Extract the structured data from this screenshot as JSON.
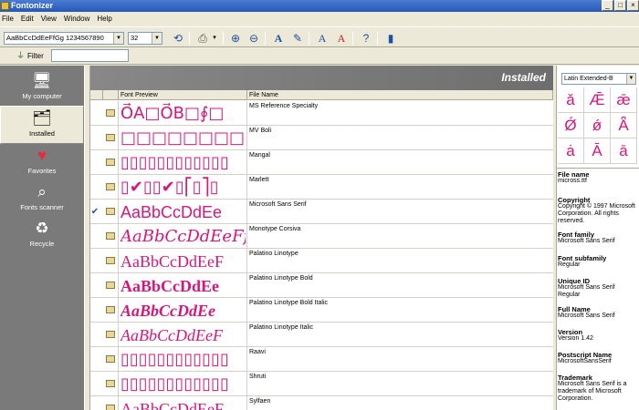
{
  "window": {
    "title": "Fontonizer"
  },
  "menu": [
    "File",
    "Edit",
    "View",
    "Window",
    "Help"
  ],
  "toolbar": {
    "sample_text": "AaBbCcDdEeFfGg 1234567890",
    "font_size": "32"
  },
  "filter": {
    "label": "Filter",
    "value": ""
  },
  "sidebar": {
    "items": [
      {
        "label": "My computer",
        "icon": "computer-icon",
        "active": false
      },
      {
        "label": "Installed",
        "icon": "installed-fonts-icon",
        "active": true
      },
      {
        "label": "Favorites",
        "icon": "heart-icon",
        "active": false
      },
      {
        "label": "Fonts scanner",
        "icon": "scanner-icon",
        "active": false
      },
      {
        "label": "Recycle",
        "icon": "recycle-icon",
        "active": false
      }
    ]
  },
  "main": {
    "banner_title": "Installed",
    "columns": {
      "preview": "Font Preview",
      "file": "File Name"
    },
    "rows": [
      {
        "preview": "O⃗A□O⃗B□∮□",
        "file": "MS Reference Specialty",
        "checked": false,
        "preview_font": "\"DejaVu Sans\", sans-serif"
      },
      {
        "preview": "□□□□□□□□□",
        "file": "MV Boli",
        "checked": false,
        "preview_font": "\"DejaVu Sans\", sans-serif"
      },
      {
        "preview": "▯▯▯▯▯▯▯▯▯▯▯▯",
        "file": "Mangal",
        "checked": false,
        "preview_font": "\"DejaVu Sans\", sans-serif"
      },
      {
        "preview": "▯✔▯▯✔▯⎡▯⎤▯",
        "file": "Marlett",
        "checked": false,
        "preview_font": "\"DejaVu Sans\", sans-serif"
      },
      {
        "preview": "AaBbCcDdEe",
        "file": "Microsoft Sans Serif",
        "checked": true,
        "preview_font": "\"Liberation Sans\", sans-serif"
      },
      {
        "preview": "AaBbCcDdEeFfGg",
        "file": "Monotype Corsiva",
        "checked": false,
        "preview_font": "\"DejaVu Serif\", serif",
        "italic": true
      },
      {
        "preview": "AaBbCcDdEeF",
        "file": "Palatino Linotype",
        "checked": false,
        "preview_font": "\"Liberation Serif\", serif"
      },
      {
        "preview": "AaBbCcDdEe",
        "file": "Palatino Linotype Bold",
        "checked": false,
        "preview_font": "\"Liberation Serif\", serif",
        "bold": true
      },
      {
        "preview": "AaBbCcDdEe",
        "file": "Palatino Linotype Bold Italic",
        "checked": false,
        "preview_font": "\"Liberation Serif\", serif",
        "bold": true,
        "italic": true
      },
      {
        "preview": "AaBbCcDdEeF",
        "file": "Palatino Linotype Italic",
        "checked": false,
        "preview_font": "\"Liberation Serif\", serif",
        "italic": true
      },
      {
        "preview": "▯▯▯▯▯▯▯▯▯▯▯▯",
        "file": "Raavi",
        "checked": false,
        "preview_font": "\"DejaVu Sans\", sans-serif"
      },
      {
        "preview": "▯▯▯▯▯▯▯▯▯▯▯▯",
        "file": "Shruti",
        "checked": false,
        "preview_font": "\"DejaVu Sans\", sans-serif"
      },
      {
        "preview": "AaBbCcDdEeF",
        "file": "Sylfaen",
        "checked": false,
        "preview_font": "\"Liberation Serif\", serif"
      }
    ]
  },
  "right_panel": {
    "charset": "Latin Extended-B",
    "glyphs": [
      "ǎ",
      "Ǣ",
      "ǣ",
      "Ǿ",
      "ǿ",
      "Ǟ",
      "ȧ",
      "Ā",
      "ā"
    ],
    "info": [
      {
        "label": "File name",
        "value": "micross.ttf"
      },
      {
        "label": "Copyright",
        "value": "Copyright © 1997 Microsoft Corporation. All rights reserved."
      },
      {
        "label": "Font family",
        "value": "Microsoft Sans Serif"
      },
      {
        "label": "Font subfamily",
        "value": "Regular"
      },
      {
        "label": "Unique ID",
        "value": "Microsoft Sans Serif Regular"
      },
      {
        "label": "Full Name",
        "value": "Microsoft Sans Serif"
      },
      {
        "label": "Version",
        "value": "Version 1.42"
      },
      {
        "label": "Postscript Name",
        "value": "MicrosoftSansSerif"
      },
      {
        "label": "Trademark",
        "value": "Microsoft Sans Serif is a trademark of Microsoft Corporation."
      }
    ]
  },
  "colors": {
    "accent": "#d6177a",
    "sidebar_bg": "#7a7a7a",
    "banner_bg": "#777777",
    "titlebar": "#2557bd"
  }
}
